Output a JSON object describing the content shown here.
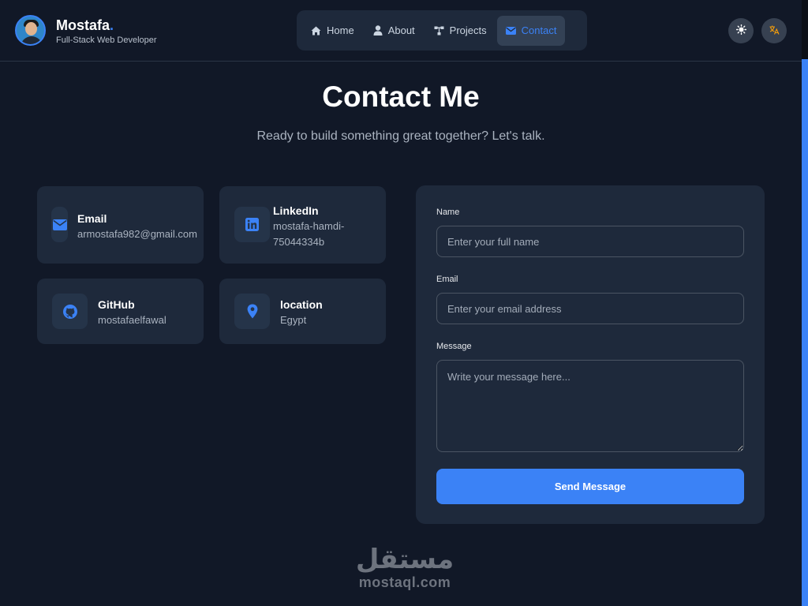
{
  "brand": {
    "name": "Mostafa",
    "dot": ".",
    "subtitle": "Full-Stack Web Developer"
  },
  "nav": {
    "items": [
      {
        "label": "Home",
        "icon": "home-icon"
      },
      {
        "label": "About",
        "icon": "user-icon"
      },
      {
        "label": "Projects",
        "icon": "sitemap-icon"
      },
      {
        "label": "Contact",
        "icon": "envelope-icon",
        "active": true
      }
    ]
  },
  "header_buttons": {
    "theme_icon": "sun-icon",
    "language_icon": "translate-icon"
  },
  "page": {
    "title": "Contact Me",
    "subtitle": "Ready to build something great together? Let's talk."
  },
  "contact_cards": [
    {
      "title": "Email",
      "value": "armostafa982@gmail.com",
      "icon": "envelope-icon"
    },
    {
      "title": "LinkedIn",
      "value": "mostafa-hamdi-75044334b",
      "icon": "linkedin-icon"
    },
    {
      "title": "GitHub",
      "value": "mostafaelfawal",
      "icon": "github-icon"
    },
    {
      "title": "location",
      "value": "Egypt",
      "icon": "location-pin-icon"
    }
  ],
  "form": {
    "name_label": "Name",
    "name_placeholder": "Enter your full name",
    "email_label": "Email",
    "email_placeholder": "Enter your email address",
    "message_label": "Message",
    "message_placeholder": "Write your message here...",
    "submit_label": "Send Message"
  },
  "watermark": {
    "arabic": "مستقل",
    "latin": "mostaql.com"
  },
  "colors": {
    "background": "#111827",
    "card": "#1e293b",
    "accent": "#3b82f6",
    "text": "#ffffff",
    "muted": "#aab3c0"
  }
}
